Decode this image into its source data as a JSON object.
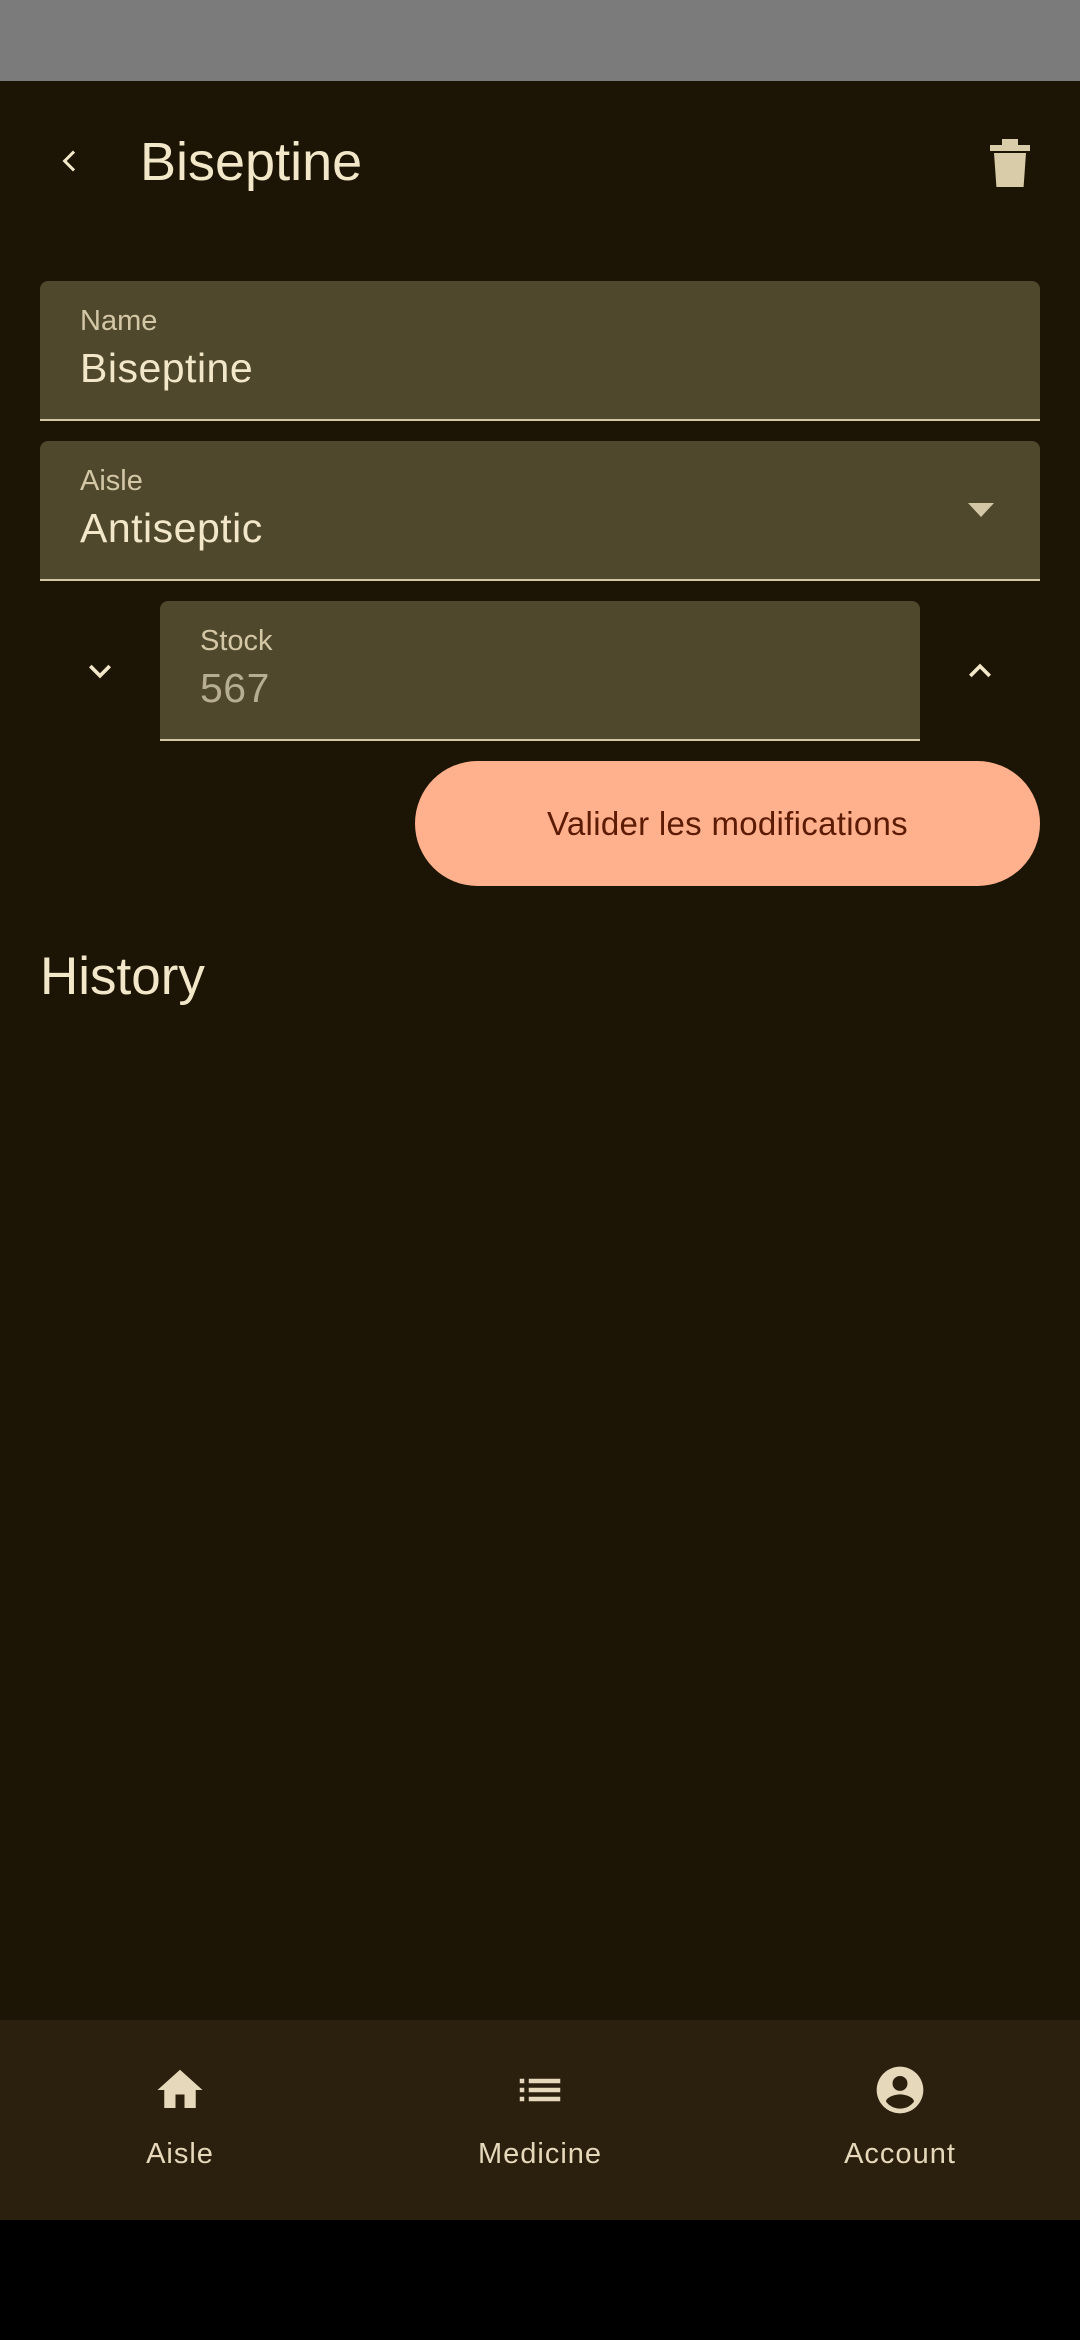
{
  "header": {
    "title": "Biseptine",
    "back_icon": "arrow-back-icon",
    "delete_icon": "trash-icon"
  },
  "form": {
    "name": {
      "label": "Name",
      "value": "Biseptine"
    },
    "aisle": {
      "label": "Aisle",
      "value": "Antiseptic"
    },
    "stock": {
      "label": "Stock",
      "value": "567"
    }
  },
  "actions": {
    "validate_label": "Valider les modifications"
  },
  "history": {
    "title": "History"
  },
  "nav": {
    "items": [
      {
        "label": "Aisle",
        "icon": "home-icon"
      },
      {
        "label": "Medicine",
        "icon": "list-icon"
      },
      {
        "label": "Account",
        "icon": "account-circle-icon"
      }
    ]
  },
  "colors": {
    "background": "#1c1404",
    "field": "#4f482d",
    "accent": "#ffb08d",
    "nav_bar": "#2b1f0e"
  }
}
